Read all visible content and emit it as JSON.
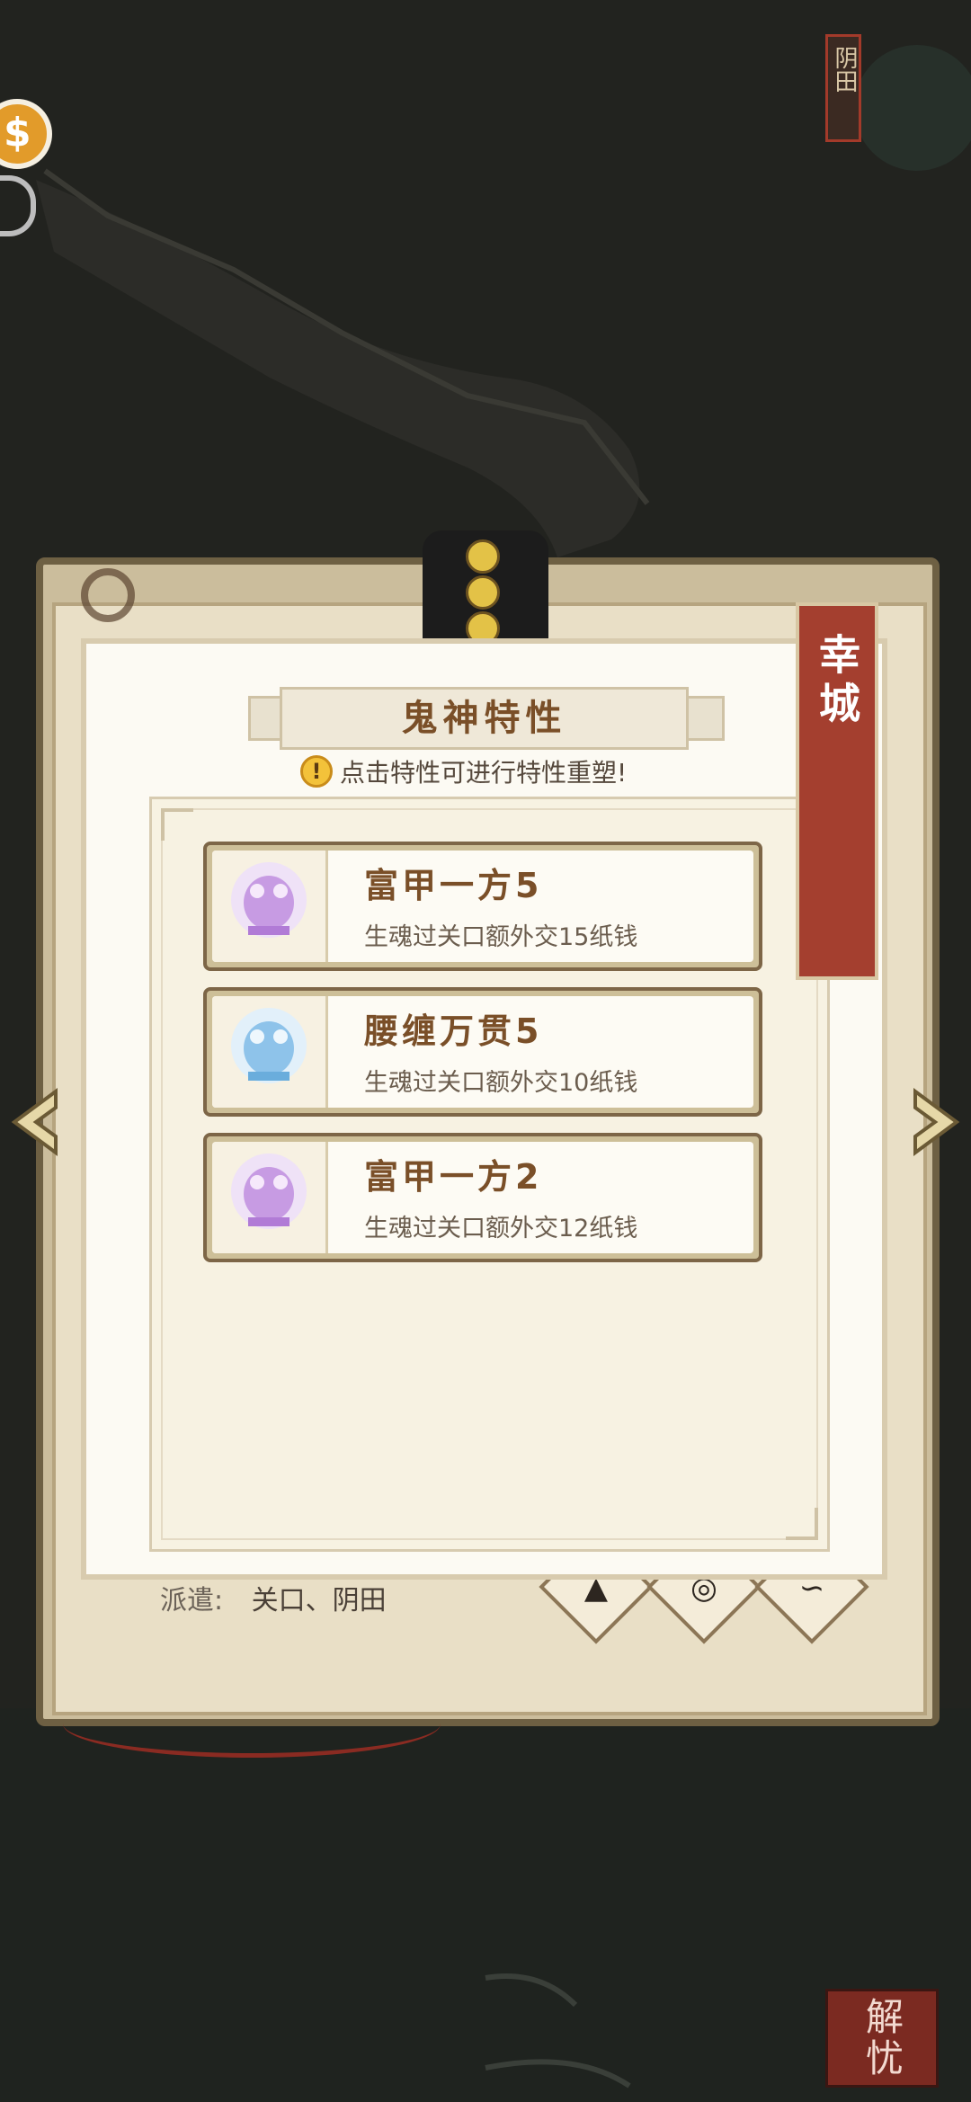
{
  "top_sign": {
    "label": "阴田"
  },
  "book": {
    "dispatch_label": "派遣:",
    "dispatch_value": "关口、阴田"
  },
  "city_tag": {
    "label": "幸城"
  },
  "panel": {
    "title": "鬼神特性",
    "hint": "点击特性可进行特性重塑!",
    "traits": [
      {
        "name": "富甲一方5",
        "desc": "生魂过关口额外交15纸钱",
        "color": "#c79be3"
      },
      {
        "name": "腰缠万贯5",
        "desc": "生魂过关口额外交10纸钱",
        "color": "#8ec3ea"
      },
      {
        "name": "富甲一方2",
        "desc": "生魂过关口额外交12纸钱",
        "color": "#c79be3"
      }
    ]
  },
  "seal": {
    "label": "解忧"
  },
  "icons": {
    "coin": "coin-icon",
    "prev": "chevron-left-icon",
    "next": "chevron-right-icon"
  }
}
